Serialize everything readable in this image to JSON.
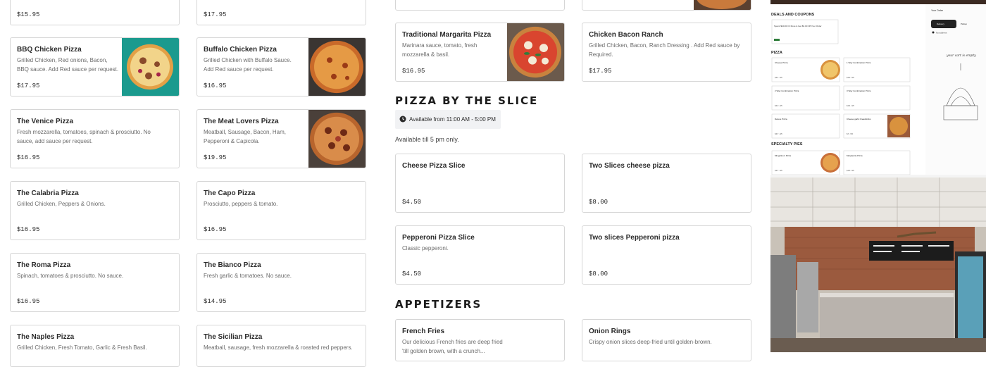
{
  "left_cards": [
    {
      "name": "",
      "desc": "",
      "price": "$15.95"
    },
    {
      "name": "",
      "desc": "",
      "price": "$17.95"
    },
    {
      "name": "BBQ Chicken Pizza",
      "desc": "Grilled Chicken, Red onions, Bacon, BBQ sauce. Add Red sauce per request.",
      "price": "$17.95"
    },
    {
      "name": "Buffalo Chicken Pizza",
      "desc": "Grilled Chicken with Buffalo Sauce. Add Red sauce per request.",
      "price": "$16.95"
    },
    {
      "name": "The Venice Pizza",
      "desc": "Fresh mozzarella, tomatoes, spinach & prosciutto. No sauce, add sauce per request.",
      "price": "$16.95"
    },
    {
      "name": "The Meat Lovers Pizza",
      "desc": "Meatball, Sausage, Bacon, Ham, Pepperoni & Capicola.",
      "price": "$19.95"
    },
    {
      "name": "The Calabria Pizza",
      "desc": "Grilled Chicken, Peppers & Onions.",
      "price": "$16.95"
    },
    {
      "name": "The Capo Pizza",
      "desc": "Prosciutto, peppers & tomato.",
      "price": "$16.95"
    },
    {
      "name": "The Roma Pizza",
      "desc": "Spinach, tomatoes & prosciutto. No sauce.",
      "price": "$16.95"
    },
    {
      "name": "The Bianco Pizza",
      "desc": "Fresh garlic & tomatoes. No sauce.",
      "price": "$14.95"
    },
    {
      "name": "The Naples Pizza",
      "desc": "Grilled Chicken, Fresh Tomato, Garlic & Fresh Basil.",
      "price": ""
    },
    {
      "name": "The Sicilian Pizza",
      "desc": "Meatball, sausage, fresh mozzarella & roasted red peppers.",
      "price": ""
    }
  ],
  "mid": {
    "top_cards": [
      {
        "name": "Traditional Margarita Pizza",
        "desc": "Marinara sauce, tomato, fresh mozzarella & basil.",
        "price": "$16.95"
      },
      {
        "name": "Chicken Bacon Ranch",
        "desc": "Grilled Chicken, Bacon, Ranch Dressing . Add Red sauce by Required.",
        "price": "$17.95"
      }
    ],
    "slice_heading": "PIZZA BY THE SLICE",
    "availability": "Available from 11:00 AM - 5:00 PM",
    "availability_note": "Available till 5 pm only.",
    "slice_cards": [
      {
        "name": "Cheese Pizza Slice",
        "desc": "",
        "price": "$4.50"
      },
      {
        "name": "Two Slices cheese pizza",
        "desc": "",
        "price": "$8.00"
      },
      {
        "name": "Pepperoni Pizza Slice",
        "desc": "Classic pepperoni.",
        "price": "$4.50"
      },
      {
        "name": "Two slices Pepperoni pizza",
        "desc": "",
        "price": "$8.00"
      }
    ],
    "appetizers_heading": "APPETIZERS",
    "appetizer_cards": [
      {
        "name": "French Fries",
        "desc": "Our delicious French fries are deep fried 'till golden brown, with a crunch..."
      },
      {
        "name": "Onion Rings",
        "desc": "Crispy onion slices deep-fried until golden-brown."
      }
    ]
  },
  "right_panel": {
    "deals_label": "DEALS AND COUPONS",
    "deal_text": "Spend $40.00 Or More & Get $3.00 Off Your Order",
    "pizza_label": "PIZZA",
    "specialty_label": "SPECIALTY PIES",
    "your_order": "Your Order",
    "delivery": "Delivery",
    "pickup": "Pickup",
    "no_address": "No address",
    "cart_empty": "your cart is empty",
    "mini_items": [
      {
        "name": "Cheese Pizza",
        "price": "$11.95"
      },
      {
        "name": "1 Way Combination Pizza",
        "price": "$12.95"
      },
      {
        "name": "2 Way Combination Pizza",
        "price": "$13.95"
      },
      {
        "name": "3 Way Combination Pizza",
        "price": "$14.95"
      },
      {
        "name": "Deluxe Pizza",
        "price": "$17.95"
      },
      {
        "name": "Cheese garlic breadsticks",
        "price": "$7.95"
      },
      {
        "name": "Mingolino's Pizza",
        "price": "$17.95"
      },
      {
        "name": "Margherita Pizza",
        "price": "$15.95"
      }
    ]
  },
  "colors": {
    "accent": "#2f7d3b",
    "border": "#d6d6d6",
    "chip": "#f1f2f4",
    "text": "#2b2b2b",
    "muted": "#6b6b6b"
  }
}
